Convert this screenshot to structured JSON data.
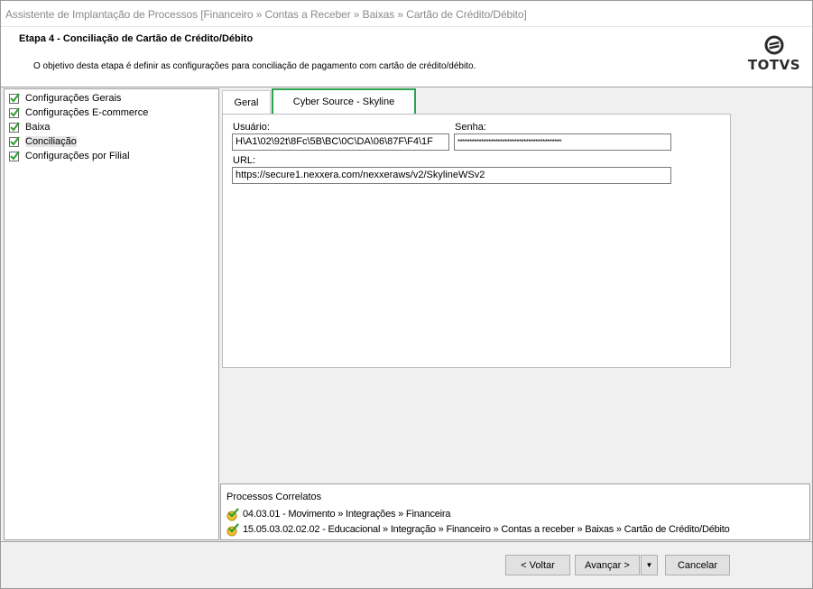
{
  "window": {
    "title": "Assistente de Implantação de Processos [Financeiro » Contas a Receber » Baixas » Cartão de Crédito/Débito]"
  },
  "header": {
    "step_title": "Etapa 4 - Conciliação de Cartão de Crédito/Débito",
    "description": "O objetivo desta etapa é definir as configurações para conciliação de pagamento com cartão de crédito/débito.",
    "logo_text": "TOTVS"
  },
  "tree": {
    "items": [
      {
        "label": "Configurações Gerais",
        "icon": "green-check-icon"
      },
      {
        "label": "Configurações E-commerce",
        "icon": "green-check-icon"
      },
      {
        "label": "Baixa",
        "icon": "green-check-icon"
      },
      {
        "label": "Conciliação",
        "icon": "green-check-icon",
        "selected": true
      },
      {
        "label": "Configurações por Filial",
        "icon": "green-check-icon"
      }
    ]
  },
  "tabs": [
    {
      "label": "Geral",
      "active": false
    },
    {
      "label": "Cyber Source - Skyline",
      "active": true
    }
  ],
  "form": {
    "usuario_label": "Usuário:",
    "usuario_value": "H\\A1\\02\\92t\\8Fc\\5B\\BC\\0C\\DA\\06\\87F\\F4\\1F",
    "senha_label": "Senha:",
    "senha_value": "********************************************",
    "url_label": "URL:",
    "url_value": "https://secure1.nexxera.com/nexxeraws/v2/SkylineWSv2"
  },
  "correlatos": {
    "title": "Processos Correlatos",
    "items": [
      {
        "text": "04.03.01 - Movimento » Integrações » Financeira",
        "icon": "process-link-icon"
      },
      {
        "text": "15.05.03.02.02.02 - Educacional » Integração » Financeiro » Contas a receber » Baixas » Cartão de Crédito/Débito",
        "icon": "process-link-icon"
      }
    ]
  },
  "footer": {
    "back_label": "< Voltar",
    "next_label": "Avançar >",
    "dropdown_glyph": "▼",
    "cancel_label": "Cancelar"
  },
  "colors": {
    "active_tab_highlight": "#2ea44f",
    "window_bg": "#f0f0f0",
    "title_text": "#8a8a8a"
  }
}
